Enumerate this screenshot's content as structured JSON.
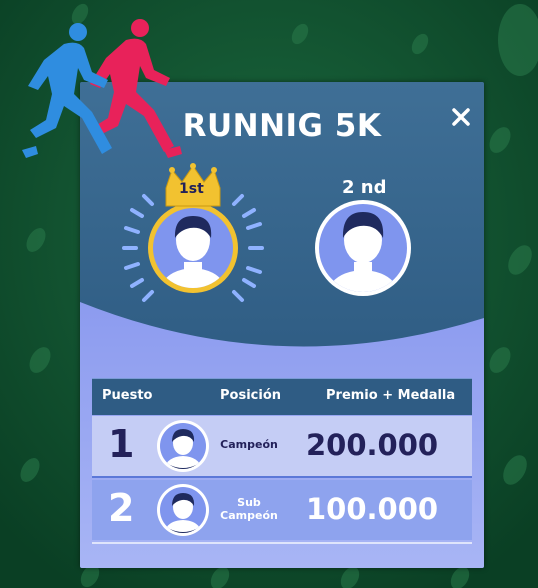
{
  "game": {
    "title": "RUNNIG 5K",
    "close_label": "✕",
    "podium": {
      "first_badge": "1st",
      "second_label": "2 nd"
    },
    "table": {
      "headers": [
        "Puesto",
        "Posición",
        "Premio + Medalla"
      ],
      "rows": [
        {
          "rank": "1",
          "position_line1": "Campeón",
          "position_line2": "",
          "prize": "200.000"
        },
        {
          "rank": "2",
          "position_line1": "Sub",
          "position_line2": "Campeón",
          "prize": "100.000"
        }
      ]
    }
  },
  "icons": {
    "runners": "runners-icon",
    "crown": "crown-icon",
    "avatar": "user-avatar-icon",
    "close": "close-icon"
  },
  "colors": {
    "background": "#0d4a2c",
    "panel": "#2d5e82",
    "gold": "#f2c230",
    "row1": "#c5cdf5",
    "row2": "#8ea3ee",
    "text_dark": "#23215a",
    "runner_blue": "#2f8de0",
    "runner_pink": "#e8225a"
  }
}
